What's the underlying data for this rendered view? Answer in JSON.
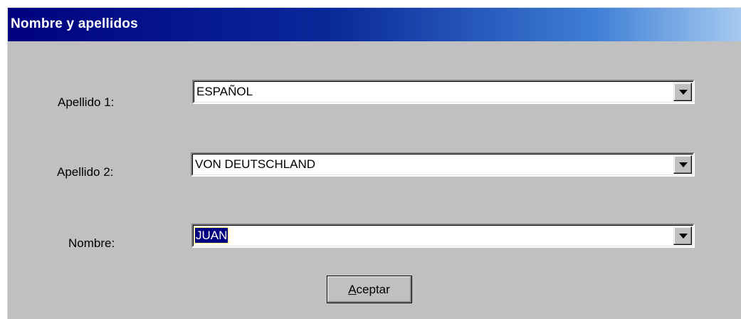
{
  "window": {
    "title": "Nombre y apellidos"
  },
  "fields": [
    {
      "label": "Apellido 1:",
      "value": "ESPAÑOL",
      "selected": false
    },
    {
      "label": "Apellido 2:",
      "value": "VON DEUTSCHLAND",
      "selected": false
    },
    {
      "label": "Nombre:",
      "value": "JUAN",
      "selected": true
    }
  ],
  "accept_button": {
    "accel": "A",
    "rest": "ceptar"
  },
  "icons": {
    "dropdown": "chevron-down-icon"
  },
  "colors": {
    "titlebar_start": "#00007f",
    "titlebar_end": "#a6caf0",
    "dialog_face": "#c0c0c0",
    "selection": "#000080"
  }
}
